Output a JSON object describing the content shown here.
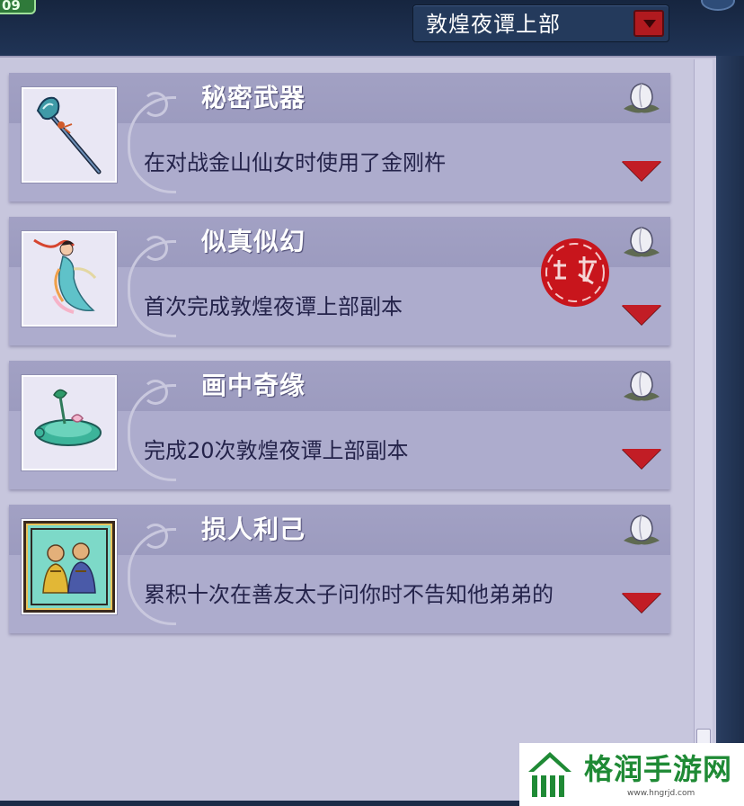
{
  "top_badge": "09",
  "chapter_select": {
    "label": "敦煌夜谭上部"
  },
  "achievements": [
    {
      "title": "秘密武器",
      "desc": "在对战金山仙女时使用了金刚杵",
      "icon": "vajra-weapon-icon",
      "completed": false
    },
    {
      "title": "似真似幻",
      "desc": "首次完成敦煌夜谭上部副本",
      "icon": "flying-apsara-icon",
      "completed": true,
      "seal_text": "完成"
    },
    {
      "title": "画中奇缘",
      "desc": "完成20次敦煌夜谭上部副本",
      "icon": "lotus-turtle-icon",
      "completed": false
    },
    {
      "title": "损人利己",
      "desc": "累积十次在善友太子问你时不告知他弟弟的",
      "icon": "two-monks-icon",
      "completed": false
    }
  ],
  "watermark": {
    "name": "格润手游网",
    "url": "www.hngrjd.com"
  },
  "colors": {
    "panel": "#c7c6dd",
    "card": "#adaccd",
    "accent_red": "#c21d25",
    "seal_red": "#c8151c",
    "watermark_green": "#1f8a35"
  }
}
